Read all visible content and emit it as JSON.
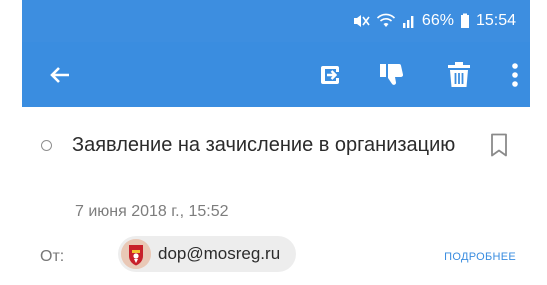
{
  "status_bar": {
    "battery_percent": "66%",
    "time": "15:54",
    "icons": [
      "mute-icon",
      "wifi-icon",
      "signal-icon",
      "battery-icon"
    ]
  },
  "app_bar": {
    "background_color": "#3a8de0",
    "icons": [
      "back-arrow-icon",
      "move-icon",
      "spam-icon",
      "delete-icon",
      "more-vert-icon"
    ]
  },
  "message": {
    "subject": "Заявление на зачисление в организацию",
    "date": "7 июня 2018 г., 15:52",
    "from_label": "От:",
    "sender_email": "dop@mosreg.ru",
    "details_link": "ПОДРОБНЕЕ",
    "accent_color": "#3a8de0"
  }
}
